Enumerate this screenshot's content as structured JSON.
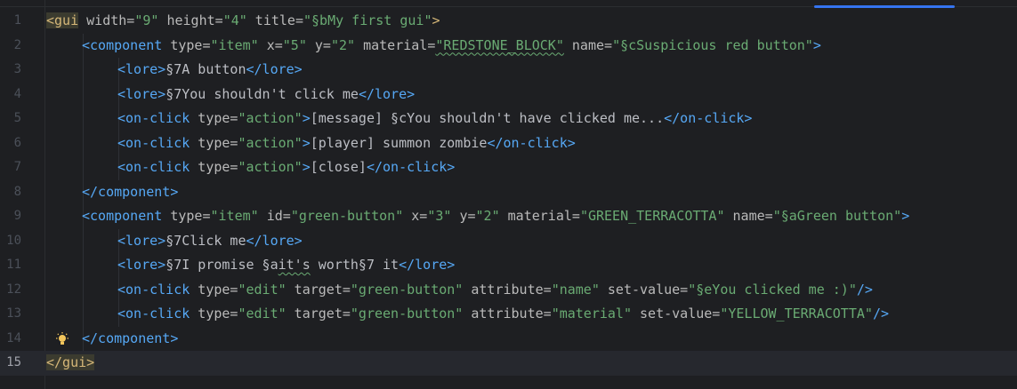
{
  "editor": {
    "current_line": 15,
    "lines": [
      {
        "num": "1",
        "tokens": [
          {
            "c": "tag tg-match",
            "t": "<gui"
          },
          {
            "c": "attr",
            "t": " width="
          },
          {
            "c": "str",
            "t": "\"9\""
          },
          {
            "c": "attr",
            "t": " height="
          },
          {
            "c": "str",
            "t": "\"4\""
          },
          {
            "c": "attr",
            "t": " title="
          },
          {
            "c": "str",
            "t": "\"§bMy first gui\""
          },
          {
            "c": "tag",
            "t": ">"
          }
        ],
        "indent": 0
      },
      {
        "num": "2",
        "tokens": [
          {
            "c": "br",
            "t": "<component"
          },
          {
            "c": "attr",
            "t": " type="
          },
          {
            "c": "str",
            "t": "\"item\""
          },
          {
            "c": "attr",
            "t": " x="
          },
          {
            "c": "str",
            "t": "\"5\""
          },
          {
            "c": "attr",
            "t": " y="
          },
          {
            "c": "str",
            "t": "\"2\""
          },
          {
            "c": "attr",
            "t": " material="
          },
          {
            "c": "str ul",
            "t": "\"REDSTONE_BLOCK\""
          },
          {
            "c": "attr",
            "t": " name="
          },
          {
            "c": "str",
            "t": "\"§cSuspicious red button\""
          },
          {
            "c": "br",
            "t": ">"
          }
        ],
        "indent": 1
      },
      {
        "num": "3",
        "tokens": [
          {
            "c": "br",
            "t": "<lore>"
          },
          {
            "c": "txt",
            "t": "§7A button"
          },
          {
            "c": "br",
            "t": "</lore>"
          }
        ],
        "indent": 2
      },
      {
        "num": "4",
        "tokens": [
          {
            "c": "br",
            "t": "<lore>"
          },
          {
            "c": "txt",
            "t": "§7You shouldn't click me"
          },
          {
            "c": "br",
            "t": "</lore>"
          }
        ],
        "indent": 2
      },
      {
        "num": "5",
        "tokens": [
          {
            "c": "br",
            "t": "<on-click"
          },
          {
            "c": "attr",
            "t": " type="
          },
          {
            "c": "str",
            "t": "\"action\""
          },
          {
            "c": "br",
            "t": ">"
          },
          {
            "c": "txt",
            "t": "[message] §cYou shouldn't have clicked me..."
          },
          {
            "c": "br",
            "t": "</on-click>"
          }
        ],
        "indent": 2
      },
      {
        "num": "6",
        "tokens": [
          {
            "c": "br",
            "t": "<on-click"
          },
          {
            "c": "attr",
            "t": " type="
          },
          {
            "c": "str",
            "t": "\"action\""
          },
          {
            "c": "br",
            "t": ">"
          },
          {
            "c": "txt",
            "t": "[player] summon zombie"
          },
          {
            "c": "br",
            "t": "</on-click>"
          }
        ],
        "indent": 2
      },
      {
        "num": "7",
        "tokens": [
          {
            "c": "br",
            "t": "<on-click"
          },
          {
            "c": "attr",
            "t": " type="
          },
          {
            "c": "str",
            "t": "\"action\""
          },
          {
            "c": "br",
            "t": ">"
          },
          {
            "c": "txt",
            "t": "[close]"
          },
          {
            "c": "br",
            "t": "</on-click>"
          }
        ],
        "indent": 2
      },
      {
        "num": "8",
        "tokens": [
          {
            "c": "br",
            "t": "</component>"
          }
        ],
        "indent": 1
      },
      {
        "num": "9",
        "tokens": [
          {
            "c": "br",
            "t": "<component"
          },
          {
            "c": "attr",
            "t": " type="
          },
          {
            "c": "str",
            "t": "\"item\""
          },
          {
            "c": "attr",
            "t": " id="
          },
          {
            "c": "str",
            "t": "\"green-button\""
          },
          {
            "c": "attr",
            "t": " x="
          },
          {
            "c": "str",
            "t": "\"3\""
          },
          {
            "c": "attr",
            "t": " y="
          },
          {
            "c": "str",
            "t": "\"2\""
          },
          {
            "c": "attr",
            "t": " material="
          },
          {
            "c": "str",
            "t": "\"GREEN_TERRACOTTA\""
          },
          {
            "c": "attr",
            "t": " name="
          },
          {
            "c": "str",
            "t": "\"§aGreen button\""
          },
          {
            "c": "br",
            "t": ">"
          }
        ],
        "indent": 1
      },
      {
        "num": "10",
        "tokens": [
          {
            "c": "br",
            "t": "<lore>"
          },
          {
            "c": "txt",
            "t": "§7Click me"
          },
          {
            "c": "br",
            "t": "</lore>"
          }
        ],
        "indent": 2
      },
      {
        "num": "11",
        "tokens": [
          {
            "c": "br",
            "t": "<lore>"
          },
          {
            "c": "txt",
            "t": "§7I promise §a"
          },
          {
            "c": "txt ul",
            "t": "it's"
          },
          {
            "c": "txt",
            "t": " worth§7 it"
          },
          {
            "c": "br",
            "t": "</lore>"
          }
        ],
        "indent": 2
      },
      {
        "num": "12",
        "tokens": [
          {
            "c": "br",
            "t": "<on-click"
          },
          {
            "c": "attr",
            "t": " type="
          },
          {
            "c": "str",
            "t": "\"edit\""
          },
          {
            "c": "attr",
            "t": " target="
          },
          {
            "c": "str",
            "t": "\"green-button\""
          },
          {
            "c": "attr",
            "t": " attribute="
          },
          {
            "c": "str",
            "t": "\"name\""
          },
          {
            "c": "attr",
            "t": " set-value="
          },
          {
            "c": "str",
            "t": "\"§eYou clicked me :)\""
          },
          {
            "c": "br",
            "t": "/>"
          }
        ],
        "indent": 2
      },
      {
        "num": "13",
        "tokens": [
          {
            "c": "br",
            "t": "<on-click"
          },
          {
            "c": "attr",
            "t": " type="
          },
          {
            "c": "str",
            "t": "\"edit\""
          },
          {
            "c": "attr",
            "t": " target="
          },
          {
            "c": "str",
            "t": "\"green-button\""
          },
          {
            "c": "attr",
            "t": " attribute="
          },
          {
            "c": "str",
            "t": "\"material\""
          },
          {
            "c": "attr",
            "t": " set-value="
          },
          {
            "c": "str",
            "t": "\"YELLOW_TERRACOTTA\""
          },
          {
            "c": "br",
            "t": "/>"
          }
        ],
        "indent": 2
      },
      {
        "num": "14",
        "tokens": [
          {
            "c": "br",
            "t": "</component>"
          }
        ],
        "indent": 1,
        "bulb": true
      },
      {
        "num": "15",
        "tokens": [
          {
            "c": "tag tg-match",
            "t": "</gui>"
          }
        ],
        "indent": 0
      }
    ],
    "bulb_icon": "lightbulb-icon"
  }
}
